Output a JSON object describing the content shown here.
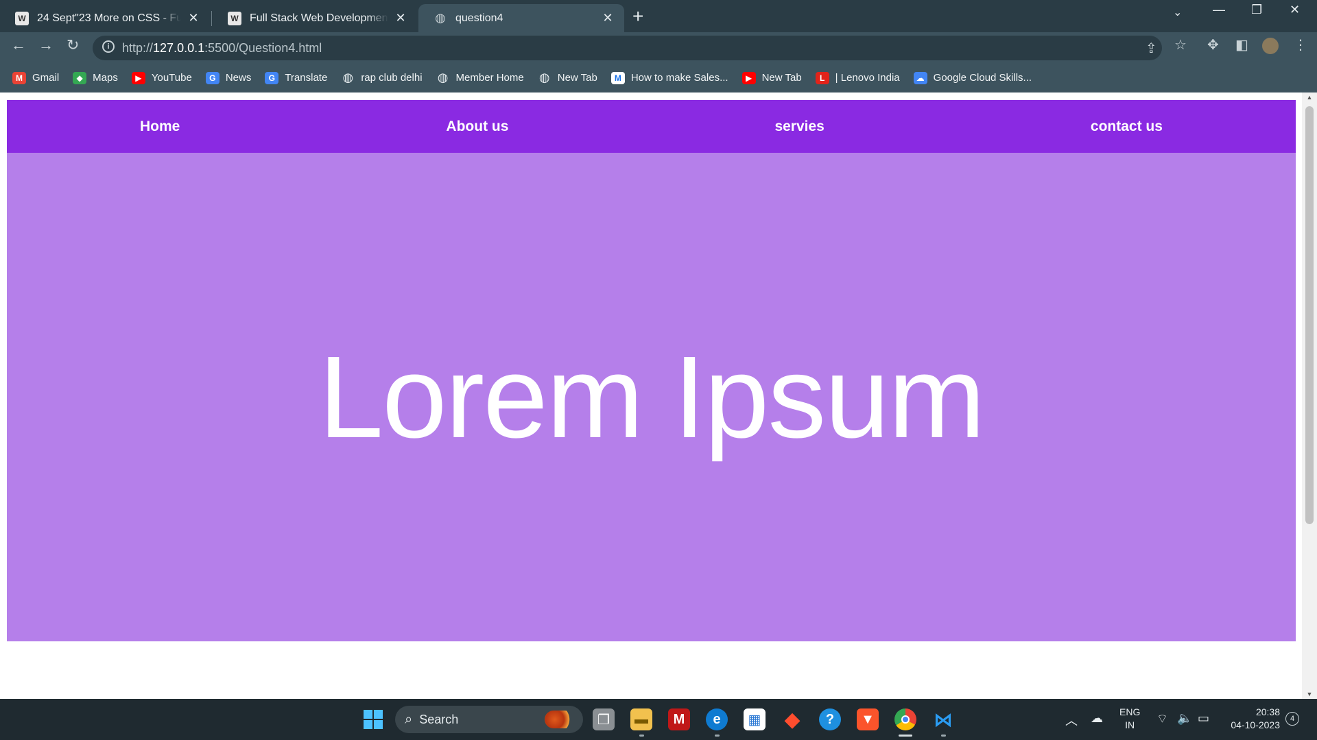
{
  "browser": {
    "tabs": [
      {
        "title": "24 Sept\"23 More on CSS - Full S",
        "favicon": "W"
      },
      {
        "title": "Full Stack Web Development - C",
        "favicon": "W"
      },
      {
        "title": "question4",
        "favicon": "◍"
      }
    ],
    "url_prefix": "http://",
    "url_host": "127.0.0.1",
    "url_rest": ":5500/Question4.html",
    "bookmarks": [
      {
        "label": "Gmail",
        "icon": "M",
        "color": "#ea4335"
      },
      {
        "label": "Maps",
        "icon": "◆",
        "color": "#34a853"
      },
      {
        "label": "YouTube",
        "icon": "▶",
        "color": "#ff0000"
      },
      {
        "label": "News",
        "icon": "G",
        "color": "#4285f4"
      },
      {
        "label": "Translate",
        "icon": "G",
        "color": "#4285f4"
      },
      {
        "label": "rap club delhi",
        "icon": "◍",
        "color": "#3d535e"
      },
      {
        "label": "Member Home",
        "icon": "◍",
        "color": "#3d535e"
      },
      {
        "label": "New Tab",
        "icon": "◍",
        "color": "#3d535e"
      },
      {
        "label": "How to make Sales...",
        "icon": "M",
        "color": "#ffffff"
      },
      {
        "label": "New Tab",
        "icon": "▶",
        "color": "#ff0000"
      },
      {
        "label": "| Lenovo India",
        "icon": "L",
        "color": "#e2231a"
      },
      {
        "label": "Google Cloud Skills...",
        "icon": "☁",
        "color": "#4285f4"
      }
    ]
  },
  "page": {
    "nav": [
      "Home",
      "About us",
      "servies",
      "contact us"
    ],
    "hero_title": "Lorem Ipsum",
    "colors": {
      "navbar": "#8a2ae2",
      "hero": "#b57fea"
    }
  },
  "taskbar": {
    "search_label": "Search",
    "lang_line1": "ENG",
    "lang_line2": "IN",
    "time": "20:38",
    "date": "04-10-2023",
    "notifications": "4"
  }
}
